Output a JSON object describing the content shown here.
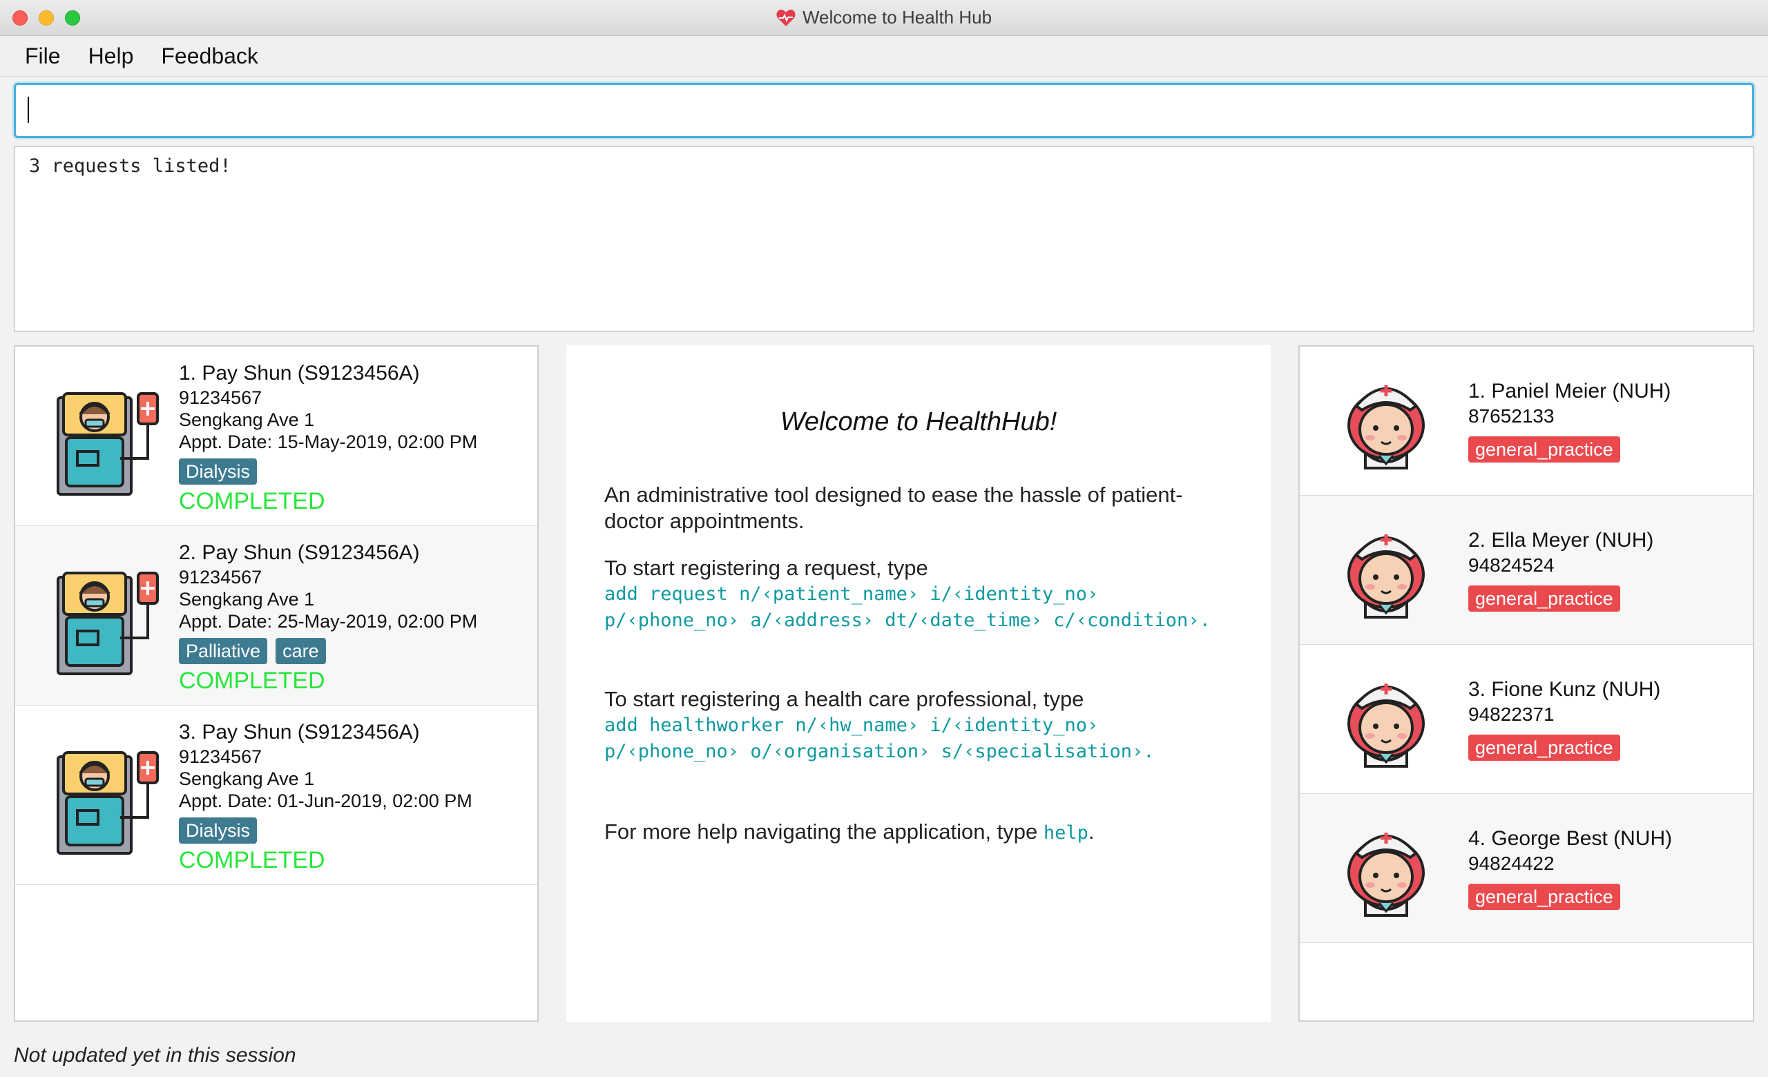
{
  "window": {
    "title": "Welcome to Health Hub"
  },
  "menu": {
    "items": [
      "File",
      "Help",
      "Feedback"
    ]
  },
  "command": {
    "value": ""
  },
  "result": {
    "text": "3 requests listed!"
  },
  "requests": [
    {
      "name": "1.  Pay Shun  (S9123456A)",
      "phone": "91234567",
      "address": "Sengkang Ave 1",
      "appt": "Appt. Date: 15-May-2019, 02:00 PM",
      "tags": [
        "Dialysis"
      ],
      "status": "COMPLETED"
    },
    {
      "name": "2.  Pay Shun  (S9123456A)",
      "phone": "91234567",
      "address": "Sengkang Ave 1",
      "appt": "Appt. Date: 25-May-2019, 02:00 PM",
      "tags": [
        "Palliative",
        "care"
      ],
      "status": "COMPLETED"
    },
    {
      "name": "3.  Pay Shun  (S9123456A)",
      "phone": "91234567",
      "address": "Sengkang Ave 1",
      "appt": "Appt. Date: 01-Jun-2019, 02:00 PM",
      "tags": [
        "Dialysis"
      ],
      "status": "COMPLETED"
    }
  ],
  "welcome": {
    "title": "Welcome to HealthHub!",
    "intro": "An administrative tool designed to ease the hassle of patient-doctor appointments.",
    "request_prompt": "To start registering a request, type",
    "request_cmd_1": "add request n/‹patient_name› i/‹identity_no›",
    "request_cmd_2": "p/‹phone_no› a/‹address› dt/‹date_time› c/‹condition›.",
    "hw_prompt": "To start registering a health care professional, type",
    "hw_cmd_1": "add healthworker n/‹hw_name› i/‹identity_no›",
    "hw_cmd_2": "p/‹phone_no› o/‹organisation› s/‹specialisation›.",
    "help_prompt": "For more help navigating the application, type",
    "help_cmd": "help",
    "help_end": "."
  },
  "healthworkers": [
    {
      "name": "1.  Paniel Meier  (NUH)",
      "phone": "87652133",
      "tag": "general_practice"
    },
    {
      "name": "2.  Ella Meyer  (NUH)",
      "phone": "94824524",
      "tag": "general_practice"
    },
    {
      "name": "3.  Fione Kunz  (NUH)",
      "phone": "94822371",
      "tag": "general_practice"
    },
    {
      "name": "4.  George Best  (NUH)",
      "phone": "94824422",
      "tag": "general_practice"
    }
  ],
  "status_bar": {
    "text": "Not updated yet in this session"
  },
  "colors": {
    "accent": "#43b1de",
    "tag_blue": "#3e7b91",
    "tag_red": "#ea4a4e",
    "completed": "#28e63a",
    "code": "#0e9aa0"
  },
  "icons": {
    "title": "heart-icon",
    "request": "patient-bed-icon",
    "healthworker": "nurse-icon"
  }
}
